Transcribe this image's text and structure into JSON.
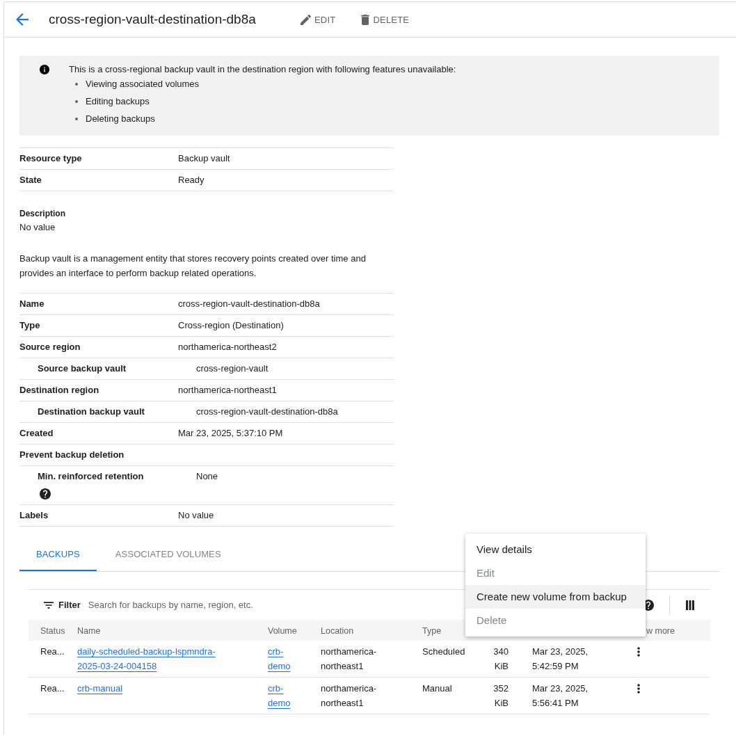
{
  "header": {
    "title": "cross-region-vault-destination-db8a",
    "actions": [
      {
        "label": "EDIT",
        "kind": "edit"
      },
      {
        "label": "DELETE",
        "kind": "delete"
      }
    ]
  },
  "notice": {
    "text": "This is a cross-regional backup vault in the destination region with following features unavailable:",
    "items": [
      "Viewing associated volumes",
      "Editing backups",
      "Deleting backups"
    ]
  },
  "summary": [
    {
      "label": "Resource type",
      "value": "Backup vault"
    },
    {
      "label": "State",
      "value": "Ready"
    }
  ],
  "description": {
    "label": "Description",
    "value": "No value"
  },
  "about": "Backup vault is a management entity that stores recovery points created over time and provides an interface to perform backup related operations.",
  "details": [
    {
      "label": "Name",
      "value": "cross-region-vault-destination-db8a"
    },
    {
      "label": "Type",
      "value": "Cross-region (Destination)"
    },
    {
      "label": "Source region",
      "value": "northamerica-northeast2",
      "children": [
        {
          "label": "Source backup vault",
          "value": "cross-region-vault",
          "help": false
        }
      ]
    },
    {
      "label": "Destination region",
      "value": "northamerica-northeast1",
      "children": [
        {
          "label": "Destination backup vault",
          "value": "cross-region-vault-destination-db8a",
          "help": false
        }
      ]
    },
    {
      "label": "Created",
      "value": "Mar 23, 2025, 5:37:10 PM"
    },
    {
      "label": "Prevent backup deletion",
      "children": [
        {
          "label": "Min. reinforced retention",
          "value": "None",
          "help": true
        }
      ]
    },
    {
      "label": "Labels",
      "value": "No value"
    }
  ],
  "tabs": [
    {
      "label": "BACKUPS",
      "selected": true
    },
    {
      "label": "ASSOCIATED VOLUMES",
      "selected": false
    }
  ],
  "backups": {
    "filter": "Filter",
    "search": {
      "placeholder": "Search for backups by name, region, etc."
    },
    "columns": {
      "status": "Status",
      "name": "Name",
      "volume": "Volume",
      "location": "Location",
      "type": "Type",
      "column_8": "w more"
    },
    "rows": [
      {
        "status": "Rea...",
        "name": "daily-scheduled-backup-lspmndra-2025-03-24-004158",
        "volume": "crb-demo",
        "location": "northamerica-northeast1",
        "type": "Scheduled",
        "column_6": "340 KiB",
        "column_7": "Mar 23, 2025, 5:42:59 PM"
      },
      {
        "status": "Rea...",
        "name": "crb-manual",
        "volume": "crb-demo",
        "location": "northamerica-northeast1",
        "type": "Manual",
        "column_6": "352 KiB",
        "column_7": "Mar 23, 2025, 5:56:41 PM"
      }
    ]
  },
  "row_menu": {
    "items": [
      {
        "label": "View details",
        "disabled": false,
        "highlighted": false
      },
      {
        "label": "Edit",
        "disabled": true,
        "highlighted": false
      },
      {
        "label": "Create new volume from backup",
        "disabled": false,
        "highlighted": true
      },
      {
        "label": "Delete",
        "disabled": true,
        "highlighted": false
      }
    ]
  }
}
